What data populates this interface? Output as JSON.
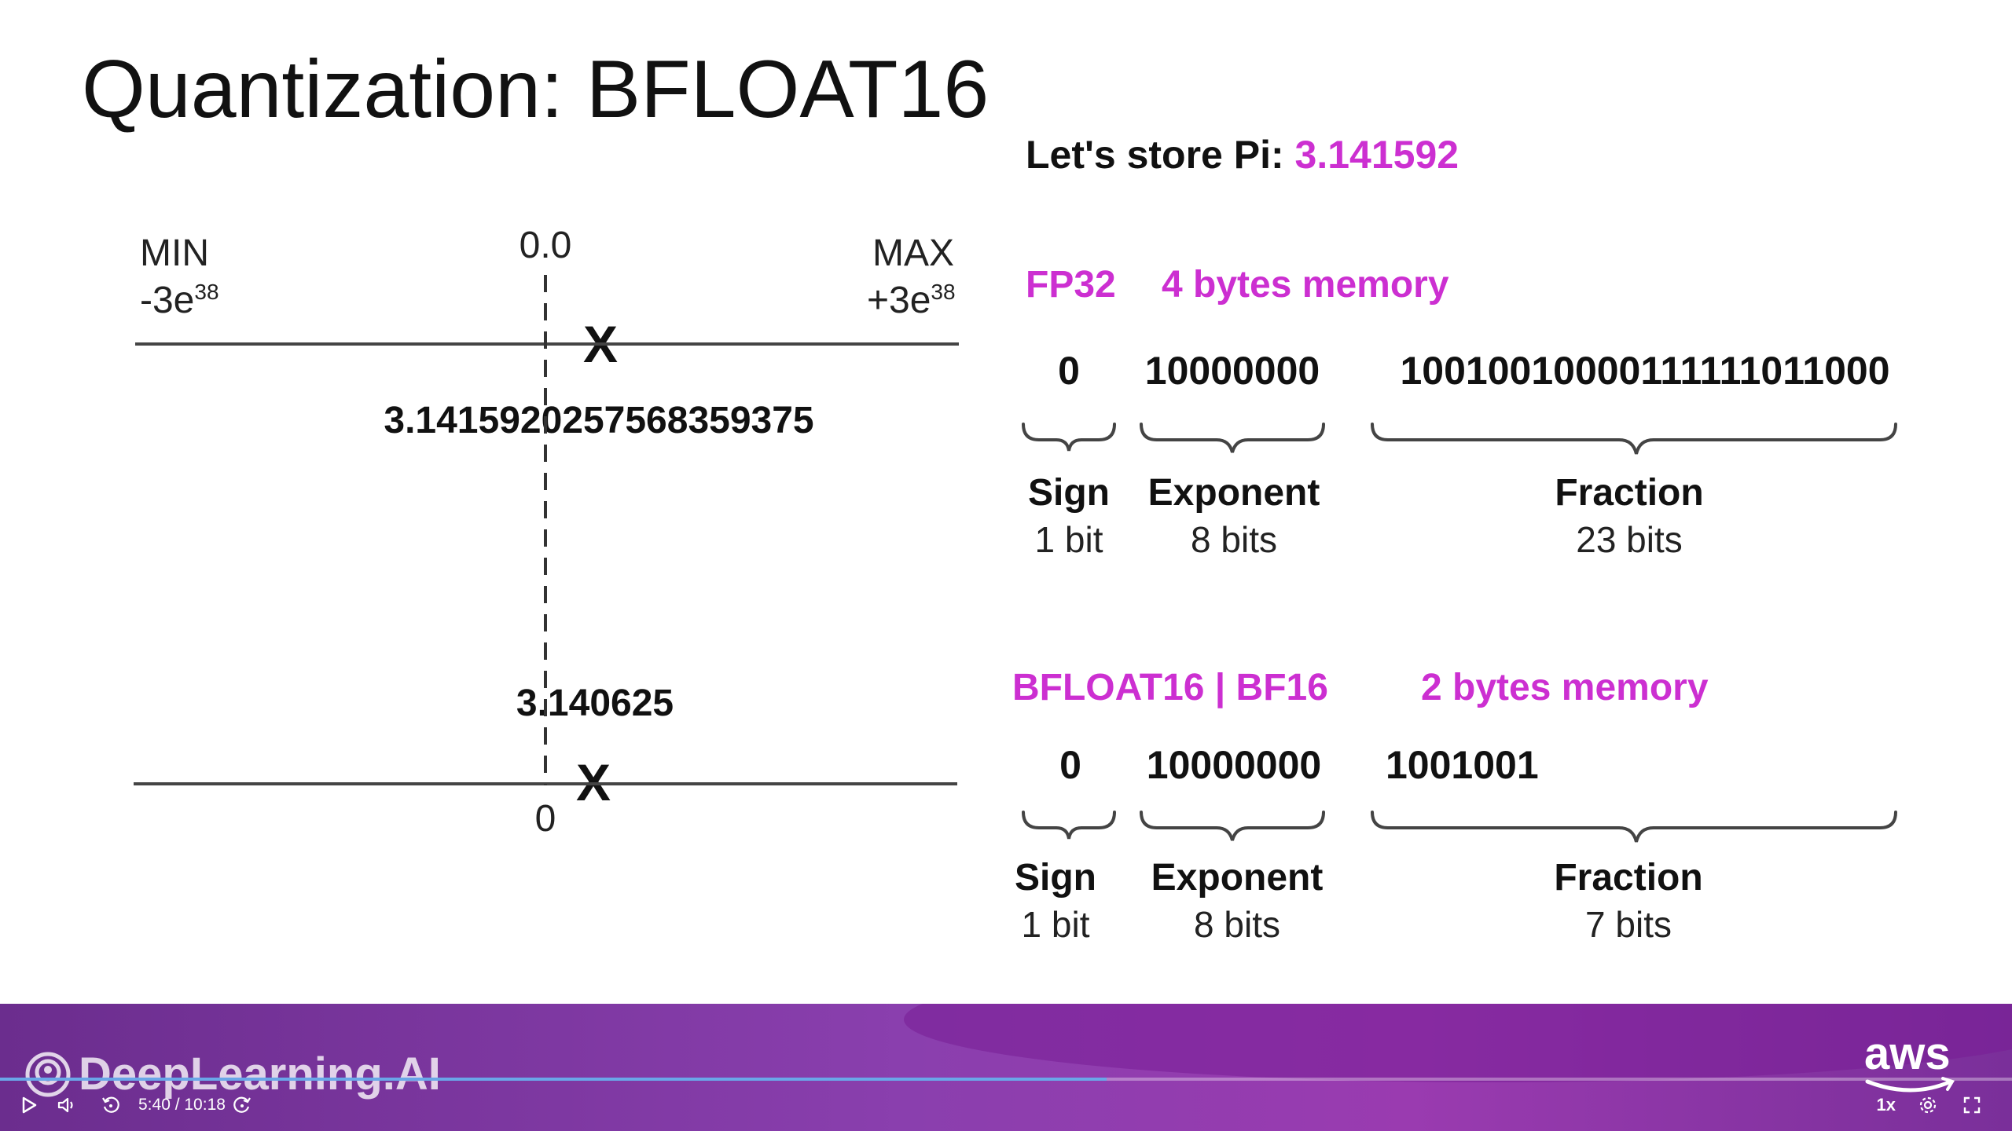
{
  "slide": {
    "title": "Quantization: BFLOAT16",
    "pi_prefix": "Let's store Pi: ",
    "pi_value": "3.141592",
    "number_line": {
      "min_label": "MIN",
      "min_base": "-3e",
      "min_exp": "38",
      "zero_label": "0.0",
      "max_label": "MAX",
      "max_base": "+3e",
      "max_exp": "38",
      "fp32_value": "3.1415920257568359375",
      "bf16_value": "3.140625",
      "bottom_zero": "0",
      "marker": "X"
    },
    "fp32": {
      "label": "FP32",
      "memory": "4 bytes memory",
      "sign_bits": "0",
      "exponent_bits": "10000000",
      "fraction_bits": "10010010000111111011000",
      "sign_label": "Sign",
      "sign_size": "1 bit",
      "exponent_label": "Exponent",
      "exponent_size": "8 bits",
      "fraction_label": "Fraction",
      "fraction_size": "23 bits"
    },
    "bf16": {
      "label": "BFLOAT16 | BF16",
      "memory": "2 bytes memory",
      "sign_bits": "0",
      "exponent_bits": "10000000",
      "fraction_bits": "1001001",
      "sign_label": "Sign",
      "sign_size": "1 bit",
      "exponent_label": "Exponent",
      "exponent_size": "8 bits",
      "fraction_label": "Fraction",
      "fraction_size": "7 bits"
    }
  },
  "branding": {
    "left_logo": "DeepLearning.AI",
    "right_logo": "aws"
  },
  "player": {
    "time": "5:40 / 10:18",
    "progress": 0.55,
    "speed": "1x",
    "icons": [
      "play-icon",
      "volume-icon",
      "rewind-icon",
      "forward-icon",
      "settings-icon",
      "fullscreen-icon"
    ]
  },
  "colors": {
    "accent": "#cc2fd1",
    "bar": "#8a3fae",
    "progress": "#6aa7e8"
  }
}
